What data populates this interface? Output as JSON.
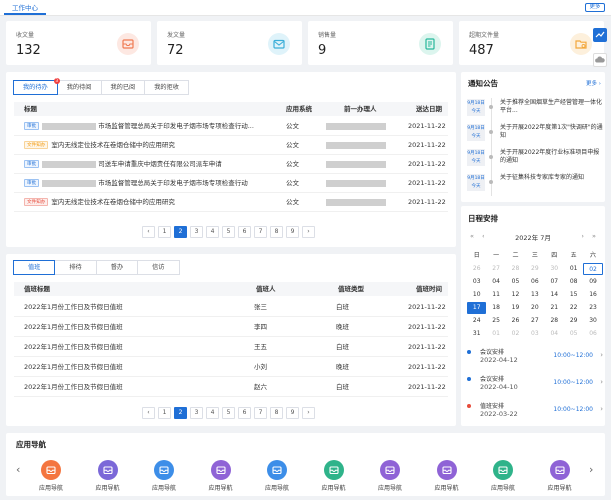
{
  "topbar": {
    "tab": "工作中心",
    "more": "更多"
  },
  "stats": [
    {
      "label": "收文量",
      "value": "132",
      "color": "#f07a52",
      "bg": "#fde8e2"
    },
    {
      "label": "发文量",
      "value": "72",
      "color": "#3aaed8",
      "bg": "#dff3fa"
    },
    {
      "label": "销售量",
      "value": "9",
      "color": "#25b89a",
      "bg": "#dcf5ee"
    },
    {
      "label": "超期文件量",
      "value": "487",
      "color": "#f3a73b",
      "bg": "#fdf0dc"
    }
  ],
  "tasks": {
    "tabs": [
      "我的待办",
      "我的待阅",
      "我的已阅",
      "我的拒收"
    ],
    "badge": "3",
    "headers": [
      "标题",
      "应用系统",
      "前一办理人",
      "送达日期"
    ],
    "rows": [
      {
        "tag": "审批",
        "tag_color": "blue",
        "title": "市场监督管理总局关于印发电子烟市场专项检查行动...",
        "system": "公文",
        "date": "2021-11-22",
        "redacted_title": true
      },
      {
        "tag": "文件知办",
        "tag_color": "orange",
        "title": "室内无线定位技术在卷烟仓储中的应用研究",
        "system": "公文",
        "date": "2021-11-22",
        "redacted_title": false
      },
      {
        "tag": "审批",
        "tag_color": "blue",
        "title": "司送车申请重庆中烟责任有限公司派车申请",
        "system": "公文",
        "date": "2021-11-22",
        "redacted_title": true
      },
      {
        "tag": "审批",
        "tag_color": "blue",
        "title": "市场监督管理总局关于印发电子烟市场专项检查行动",
        "system": "公文",
        "date": "2021-11-22",
        "redacted_title": true
      },
      {
        "tag": "文件知办",
        "tag_color": "red",
        "title": "室内无线定位技术在卷烟仓储中的应用研究",
        "system": "公文",
        "date": "2021-11-22",
        "redacted_title": false
      }
    ],
    "pages": [
      "1",
      "2",
      "3",
      "4",
      "5",
      "6",
      "7",
      "8",
      "9"
    ],
    "active_page": "2"
  },
  "duty": {
    "tabs": [
      "值班",
      "排待",
      "督办",
      "信访"
    ],
    "headers": [
      "值班标题",
      "值班人",
      "值班类型",
      "值班时间"
    ],
    "rows": [
      {
        "title": "2022年1月份工作日及节假日值班",
        "person": "张三",
        "type": "白班",
        "date": "2021-11-22"
      },
      {
        "title": "2022年1月份工作日及节假日值班",
        "person": "李四",
        "type": "晚班",
        "date": "2021-11-22"
      },
      {
        "title": "2022年1月份工作日及节假日值班",
        "person": "王五",
        "type": "白班",
        "date": "2021-11-22"
      },
      {
        "title": "2022年1月份工作日及节假日值班",
        "person": "小刘",
        "type": "晚班",
        "date": "2021-11-22"
      },
      {
        "title": "2022年1月份工作日及节假日值班",
        "person": "赵六",
        "type": "白班",
        "date": "2021-11-22"
      }
    ],
    "pages": [
      "1",
      "2",
      "3",
      "4",
      "5",
      "6",
      "7",
      "8",
      "9"
    ],
    "active_page": "2"
  },
  "notices": {
    "title": "通知公告",
    "more": "更多",
    "items": [
      {
        "date": "9月18日",
        "day": "今天",
        "text": "关于推荐全国烟草生产经营管理一体化平台..."
      },
      {
        "date": "9月18日",
        "day": "今天",
        "text": "关于开展2022年度第1次\"快调研\"的通知"
      },
      {
        "date": "9月18日",
        "day": "今天",
        "text": "关于开展2022年度行业标准项目申报的通知"
      },
      {
        "date": "9月18日",
        "day": "今天",
        "text": "关于征集科技专家库专家的通知"
      }
    ]
  },
  "calendar": {
    "title": "日程安排",
    "month_label": "2022年 7月",
    "weekdays": [
      "日",
      "一",
      "二",
      "三",
      "四",
      "五",
      "六"
    ],
    "weeks": [
      [
        "26",
        "27",
        "28",
        "29",
        "30",
        "01",
        "02"
      ],
      [
        "03",
        "04",
        "05",
        "06",
        "07",
        "08",
        "09"
      ],
      [
        "10",
        "11",
        "12",
        "13",
        "14",
        "15",
        "16"
      ],
      [
        "17",
        "18",
        "19",
        "20",
        "21",
        "22",
        "23"
      ],
      [
        "24",
        "25",
        "26",
        "27",
        "28",
        "29",
        "30"
      ],
      [
        "31",
        "01",
        "02",
        "03",
        "04",
        "05",
        "06"
      ]
    ],
    "events": [
      {
        "name": "会议安排",
        "date": "2022-04-12",
        "time": "10:00~12:00",
        "color": "#1f6fd6"
      },
      {
        "name": "会议安排",
        "date": "2022-04-10",
        "time": "10:00~12:00",
        "color": "#1f6fd6"
      },
      {
        "name": "值班安排",
        "date": "2022-03-22",
        "time": "10:00~12:00",
        "color": "#e74c3c"
      }
    ]
  },
  "apps": {
    "title": "应用导航",
    "items": [
      {
        "label": "应用导航",
        "color": "#f4753f"
      },
      {
        "label": "应用导航",
        "color": "#7b68d8"
      },
      {
        "label": "应用导航",
        "color": "#3d8ee8"
      },
      {
        "label": "应用导航",
        "color": "#8f63d6"
      },
      {
        "label": "应用导航",
        "color": "#3d8ee8"
      },
      {
        "label": "应用导航",
        "color": "#2fb38a"
      },
      {
        "label": "应用导航",
        "color": "#8f63d6"
      },
      {
        "label": "应用导航",
        "color": "#8f63d6"
      },
      {
        "label": "应用导航",
        "color": "#2fb38a"
      },
      {
        "label": "应用导航",
        "color": "#8f63d6"
      }
    ]
  }
}
